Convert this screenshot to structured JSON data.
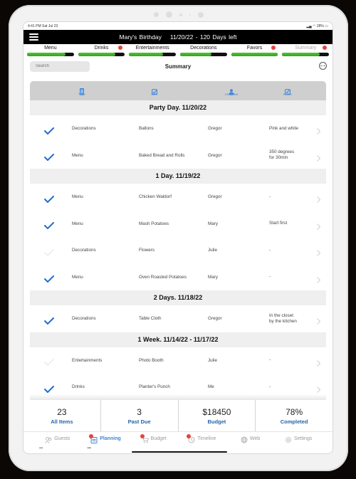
{
  "status_bar": {
    "time": "4:41 PM",
    "date": "Sat Jul 23",
    "battery": "28%"
  },
  "header": {
    "event_name": "Mary's Birthday",
    "date_info": "11/20/22 - 120 Days left"
  },
  "categories": [
    {
      "label": "Menu",
      "progress": 0.82,
      "badge": false,
      "muted": false
    },
    {
      "label": "Drinks",
      "progress": 0.8,
      "badge": true,
      "muted": false
    },
    {
      "label": "Entertainments",
      "progress": 0.73,
      "badge": false,
      "muted": false
    },
    {
      "label": "Decorations",
      "progress": 0.67,
      "badge": false,
      "muted": false
    },
    {
      "label": "Favors",
      "progress": 1.0,
      "badge": true,
      "muted": false
    },
    {
      "label": "Summary",
      "progress": 0.8,
      "badge": true,
      "muted": true
    }
  ],
  "search": {
    "placeholder": "Search"
  },
  "page_title": "Summary",
  "columns": [
    {
      "label": "Type",
      "icon": "list-icon"
    },
    {
      "label": "Item",
      "icon": "checkbox-icon"
    },
    {
      "label": "Assignee",
      "icon": "person-icon"
    },
    {
      "label": "Notes",
      "icon": "edit-icon"
    }
  ],
  "sections": [
    {
      "title": "Party Day. 11/20/22",
      "rows": [
        {
          "done": true,
          "type": "Decorations",
          "item": "Ballons",
          "assignee": "Gregor",
          "notes": "Pink and white"
        },
        {
          "done": true,
          "type": "Menu",
          "item": "Baked Bread and Rolls",
          "assignee": "Gregor",
          "notes": "350 degrees\nfor 30min"
        }
      ]
    },
    {
      "title": "1 Day. 11/19/22",
      "rows": [
        {
          "done": true,
          "type": "Menu",
          "item": "Chicken Waldorf",
          "assignee": "Gregor",
          "notes": "-"
        },
        {
          "done": true,
          "type": "Menu",
          "item": "Mash Potatoes",
          "assignee": "Mary",
          "notes": "Start first"
        },
        {
          "done": false,
          "type": "Decorations",
          "item": "Flowers",
          "assignee": "Julie",
          "notes": "-"
        },
        {
          "done": true,
          "type": "Menu",
          "item": "Oven Roasted Potatoes",
          "assignee": "Mary",
          "notes": "-"
        }
      ]
    },
    {
      "title": "2 Days. 11/18/22",
      "rows": [
        {
          "done": true,
          "type": "Decorations",
          "item": "Table Cloth",
          "assignee": "Gregor",
          "notes": "In the closet\nby the kitchen"
        }
      ]
    },
    {
      "title": "1 Week. 11/14/22 - 11/17/22",
      "rows": [
        {
          "done": false,
          "type": "Entertainments",
          "item": "Photo Booth",
          "assignee": "Julie",
          "notes": "-"
        },
        {
          "done": true,
          "type": "Drinks",
          "item": "Planter's Punch",
          "assignee": "Me",
          "notes": "-"
        }
      ]
    }
  ],
  "stats": [
    {
      "value": "23",
      "label": "All Items"
    },
    {
      "value": "3",
      "label": "Past Due"
    },
    {
      "value": "$18450",
      "label": "Budget"
    },
    {
      "value": "78%",
      "label": "Completed"
    }
  ],
  "tabs": [
    {
      "label": "Guests",
      "icon": "guests-icon",
      "active": false,
      "badge": false,
      "dots": true
    },
    {
      "label": "Planning",
      "icon": "planning-icon",
      "active": true,
      "badge": true,
      "dots": true
    },
    {
      "label": "Budget",
      "icon": "cart-icon",
      "active": false,
      "badge": true,
      "dots": false
    },
    {
      "label": "Timeline",
      "icon": "clock-icon",
      "active": false,
      "badge": true,
      "dots": false
    },
    {
      "label": "Web",
      "icon": "globe-icon",
      "active": false,
      "badge": false,
      "dots": false
    },
    {
      "label": "Settings",
      "icon": "gear-icon",
      "active": false,
      "badge": false,
      "dots": false
    }
  ],
  "colors": {
    "accent": "#3f86d8",
    "check": "#1f6fd1",
    "badge": "#e2453f",
    "progress": "#3fb526",
    "stat_label": "#2563a8"
  }
}
